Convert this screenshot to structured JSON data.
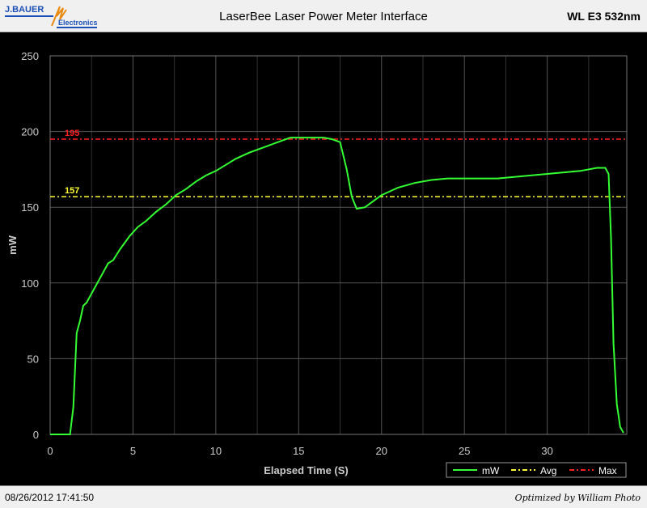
{
  "header": {
    "logo_top": "J.BAUER",
    "logo_bottom": "Electronics",
    "title": "LaserBee Laser Power Meter Interface",
    "subtitle": "WL E3 532nm"
  },
  "footer": {
    "timestamp": "08/26/2012 17:41:50",
    "credit": "Optimized by William Photo"
  },
  "colors": {
    "background": "#000000",
    "grid": "#555555",
    "axis_text": "#cccccc",
    "series": "#33ff33",
    "avg": "#ffff33",
    "max": "#ff2020"
  },
  "chart_data": {
    "type": "line",
    "xlabel": "Elapsed Time (S)",
    "ylabel": "mW",
    "xlim": [
      0,
      34.8
    ],
    "ylim": [
      0,
      250
    ],
    "xticks": [
      0,
      5,
      10,
      15,
      20,
      25,
      30
    ],
    "yticks": [
      0,
      50,
      100,
      150,
      200,
      250
    ],
    "grid": true,
    "legend_position": "bottom-right",
    "series": [
      {
        "name": "mW",
        "x": [
          0,
          1.2,
          1.4,
          1.6,
          1.8,
          2.0,
          2.2,
          2.5,
          3.0,
          3.5,
          3.8,
          4.2,
          4.8,
          5.3,
          5.8,
          6.4,
          7.0,
          7.6,
          8.2,
          8.8,
          9.4,
          10.0,
          10.6,
          11.2,
          12.0,
          13.0,
          14.0,
          14.5,
          15.5,
          16.5,
          17.0,
          17.5,
          17.9,
          18.2,
          18.5,
          19.0,
          19.5,
          20.0,
          21.0,
          22.0,
          23.0,
          24.0,
          25.0,
          26.0,
          27.0,
          28.0,
          29.0,
          30.0,
          31.0,
          32.0,
          33.0,
          33.5,
          33.7,
          33.85,
          34.0,
          34.2,
          34.4,
          34.6
        ],
        "y": [
          0,
          0,
          18,
          67,
          75,
          85,
          87,
          93,
          103,
          113,
          115,
          122,
          131,
          137,
          141,
          147,
          152,
          158,
          162,
          167,
          171,
          174,
          178,
          182,
          186,
          190,
          194,
          196,
          196,
          196,
          195,
          193,
          175,
          157,
          149,
          150,
          154,
          158,
          163,
          166,
          168,
          169,
          169,
          169,
          169,
          170,
          171,
          172,
          173,
          174,
          176,
          176,
          172,
          130,
          60,
          20,
          5,
          1
        ]
      },
      {
        "name": "Avg",
        "value": 157,
        "label": "157"
      },
      {
        "name": "Max",
        "value": 195,
        "label": "195"
      }
    ]
  }
}
